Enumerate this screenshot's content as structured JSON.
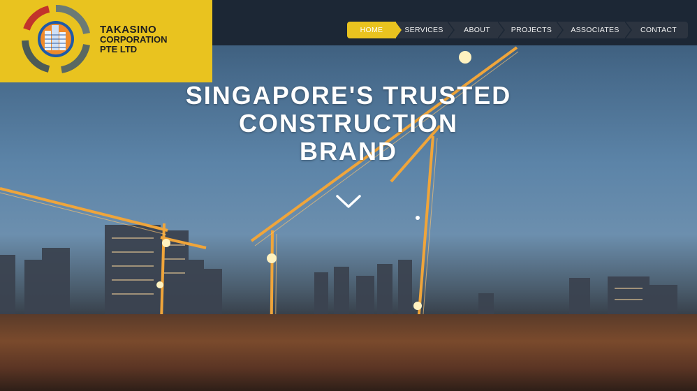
{
  "brand": {
    "line1": "TAKASINO",
    "line2": "CORPORATION",
    "line3": "PTE LTD",
    "accent_color": "#e9c31f",
    "logo_icon": "company-logo-ring-building"
  },
  "nav": {
    "items": [
      {
        "label": "HOME",
        "active": true
      },
      {
        "label": "SERVICES",
        "active": false
      },
      {
        "label": "ABOUT",
        "active": false
      },
      {
        "label": "PROJECTS",
        "active": false
      },
      {
        "label": "ASSOCIATES",
        "active": false
      },
      {
        "label": "CONTACT",
        "active": false
      }
    ]
  },
  "hero": {
    "headline_line1": "SINGAPORE'S TRUSTED",
    "headline_line2": "CONSTRUCTION",
    "headline_line3": "BRAND",
    "scroll_icon": "chevron-down-icon",
    "background": "construction-site-cranes-at-dusk"
  },
  "colors": {
    "topbar": "#1c2735",
    "nav_bg": "#2c3440",
    "active_tab": "#e9c31f"
  }
}
